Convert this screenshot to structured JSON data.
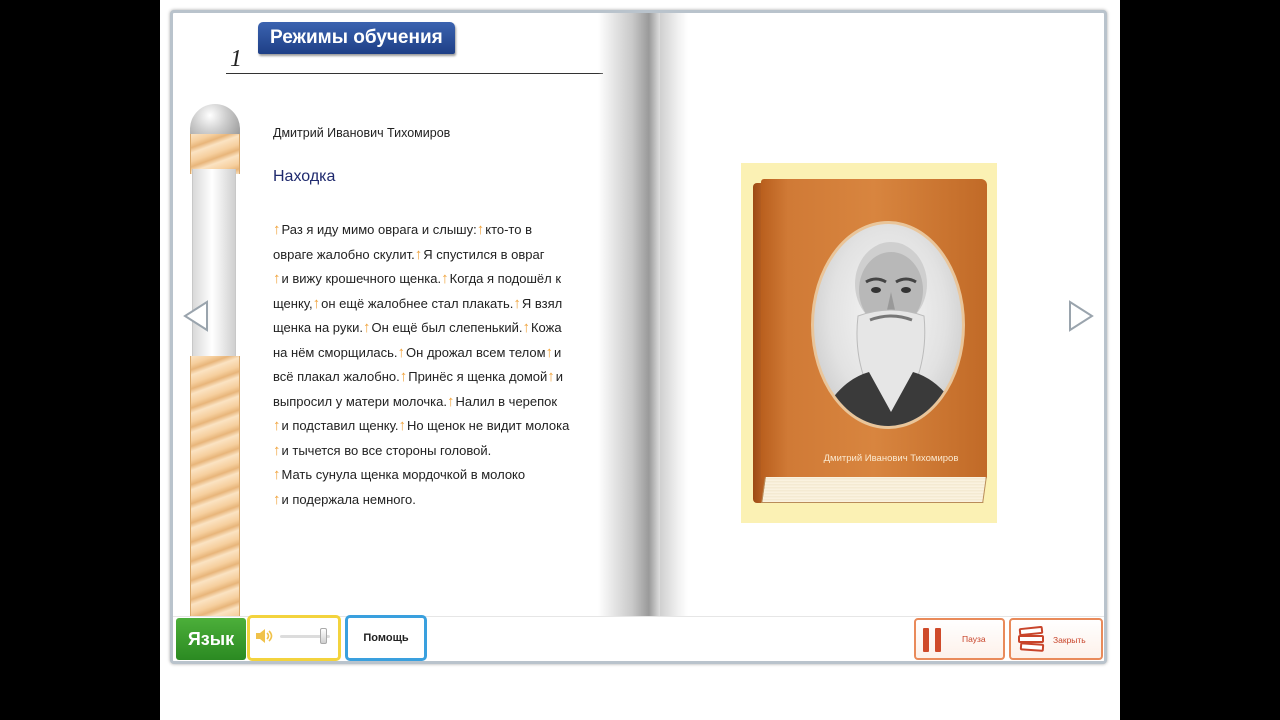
{
  "header": {
    "mode_tab": "Режимы обучения",
    "page_number": "1"
  },
  "left_page": {
    "author": "Дмитрий Иванович Тихомиров",
    "title": "Находка",
    "lines": [
      [
        {
          "mark": true,
          "text": "Раз я иду мимо оврага и слышу:"
        },
        {
          "mark": true,
          "text": "кто-то в"
        }
      ],
      [
        {
          "mark": false,
          "text": "овраге жалобно скулит."
        },
        {
          "mark": true,
          "text": "Я спустился в овраг"
        }
      ],
      [
        {
          "mark": true,
          "text": "и вижу крошечного щенка."
        },
        {
          "mark": true,
          "text": "Когда я подошёл к"
        }
      ],
      [
        {
          "mark": false,
          "text": "щенку,"
        },
        {
          "mark": true,
          "text": "он ещё жалобнее стал плакать."
        },
        {
          "mark": true,
          "text": "Я взял"
        }
      ],
      [
        {
          "mark": false,
          "text": "щенка на руки."
        },
        {
          "mark": true,
          "text": "Он ещё был слепенький."
        },
        {
          "mark": true,
          "text": "Кожа"
        }
      ],
      [
        {
          "mark": false,
          "text": "на нём сморщилась."
        },
        {
          "mark": true,
          "text": "Он дрожал всем телом"
        },
        {
          "mark": true,
          "text": "и"
        }
      ],
      [
        {
          "mark": false,
          "text": "всё плакал жалобно."
        },
        {
          "mark": true,
          "text": "Принёс я щенка домой"
        },
        {
          "mark": true,
          "text": "и"
        }
      ],
      [
        {
          "mark": false,
          "text": "выпросил у матери молочка."
        },
        {
          "mark": true,
          "text": "Налил в черепок"
        }
      ],
      [
        {
          "mark": true,
          "text": "и подставил щенку."
        },
        {
          "mark": true,
          "text": "Но щенок не видит молока"
        }
      ],
      [
        {
          "mark": true,
          "text": "и тычется во все стороны головой."
        }
      ],
      [
        {
          "mark": true,
          "text": "Мать сунула щенка мордочкой в молоко"
        }
      ],
      [
        {
          "mark": true,
          "text": "и подержала немного."
        }
      ]
    ]
  },
  "right_page": {
    "cover_name": "Дмитрий Иванович Тихомиров"
  },
  "toolbar": {
    "language_label": "Язык",
    "help_label": "Помощь",
    "pause_label": "Пауза",
    "close_label": "Закрыть",
    "volume_level": 0.85
  },
  "colors": {
    "mode_tab": "#2a4c9a",
    "text_marker": "#f0a23a",
    "title": "#1f2a6e",
    "language_button": "#3b9c2e",
    "volume_border": "#f3d33d",
    "help_border": "#3aa0de",
    "action_border": "#e98a5a"
  },
  "icons": {
    "nav_prev": "triangle-left-outline",
    "nav_next": "triangle-right-outline",
    "volume": "speaker-icon",
    "pause": "pause-icon",
    "close": "books-stack-icon"
  }
}
